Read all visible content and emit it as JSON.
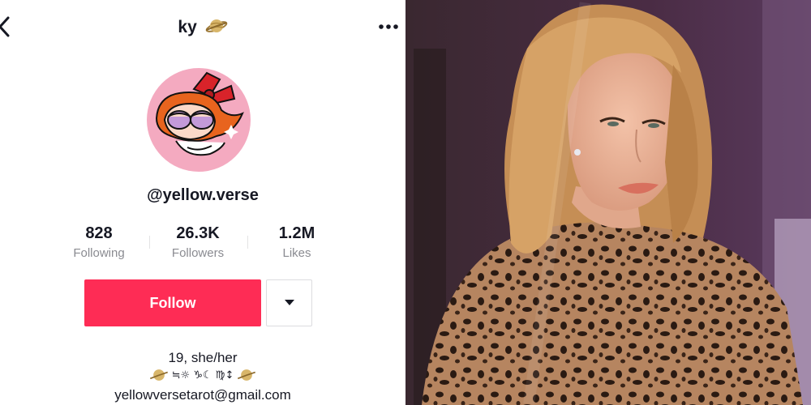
{
  "profile": {
    "title": "ky",
    "title_icon": "planet-emoji",
    "username": "@yellow.verse",
    "stats": [
      {
        "value": "828",
        "label": "Following"
      },
      {
        "value": "26.3K",
        "label": "Followers"
      },
      {
        "value": "1.2M",
        "label": "Likes"
      }
    ],
    "follow_label": "Follow",
    "bio": {
      "line1": "19, she/her",
      "symbols": "≒☼ ♑☾ ♍↕",
      "email": "yellowversetarot@gmail.com"
    }
  },
  "colors": {
    "follow_button": "#fe2c55",
    "avatar_background": "#f4aac0",
    "text_primary": "#161823",
    "text_secondary": "#8a8b91"
  },
  "photo": {
    "subject": "smiling-woman-portrait"
  }
}
